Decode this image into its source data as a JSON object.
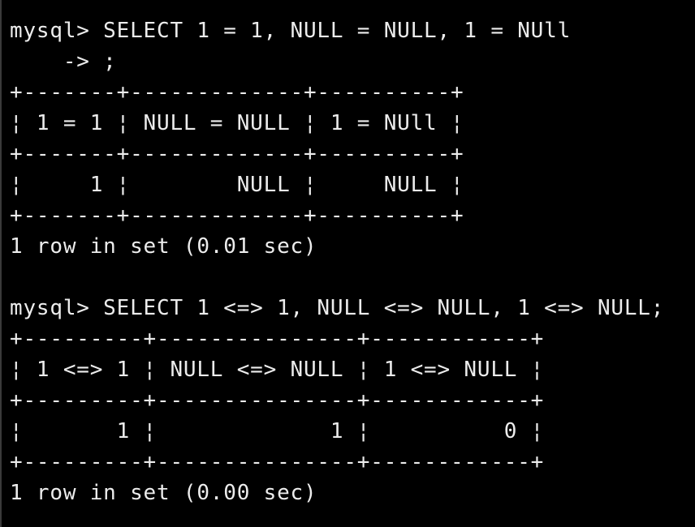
{
  "terminal": {
    "lines": [
      "mysql> SELECT 1 = 1, NULL = NULL, 1 = NUll",
      "    -> ;",
      "+-------+-------------+----------+",
      "¦ 1 = 1 ¦ NULL = NULL ¦ 1 = NUll ¦",
      "+-------+-------------+----------+",
      "¦     1 ¦        NULL ¦     NULL ¦",
      "+-------+-------------+----------+",
      "1 row in set (0.01 sec)",
      "",
      "mysql> SELECT 1 <=> 1, NULL <=> NULL, 1 <=> NULL;",
      "+---------+---------------+------------+",
      "¦ 1 <=> 1 ¦ NULL <=> NULL ¦ 1 <=> NULL ¦",
      "+---------+---------------+------------+",
      "¦       1 ¦             1 ¦          0 ¦",
      "+---------+---------------+------------+",
      "1 row in set (0.00 sec)"
    ]
  }
}
